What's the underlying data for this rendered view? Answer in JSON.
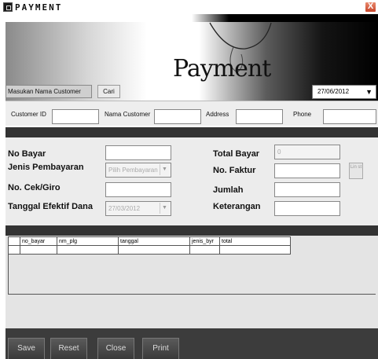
{
  "window": {
    "title": "PAYMENT",
    "close_glyph": "X"
  },
  "banner": {
    "logo_text": "Payment",
    "search_label": "Masukan Nama Customer",
    "search_button": "Cari",
    "date_value": "27/06/2012",
    "date_arrow": "▼"
  },
  "customer": {
    "id_label": "Customer ID",
    "name_label": "Nama Customer",
    "address_label": "Address",
    "phone_label": "Phone"
  },
  "form": {
    "no_bayar_label": "No Bayar",
    "jenis_label": "Jenis Pembayaran",
    "jenis_value": "Pilih Pembayaran",
    "cek_label": "No. Cek/Giro",
    "tanggal_label": "Tanggal Efektif Dana",
    "tanggal_value": "27/03/2012",
    "total_label": "Total Bayar",
    "total_value": "0",
    "faktur_label": "No. Faktur",
    "jumlah_label": "Jumlah",
    "keterangan_label": "Keterangan",
    "lin_button": "Lin st",
    "select_arrow": "▼"
  },
  "grid": {
    "columns": [
      "no_bayar",
      "nm_plg",
      "tanggal",
      "jenis_byr",
      "total"
    ]
  },
  "footer": {
    "save": "Save",
    "reset": "Reset",
    "close": "Close",
    "print": "Print"
  }
}
